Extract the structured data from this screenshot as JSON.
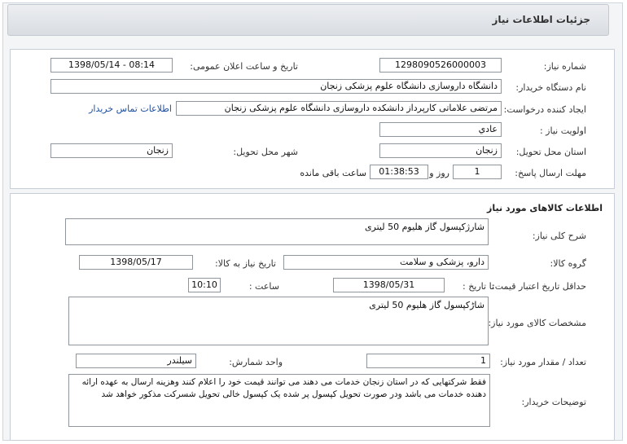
{
  "header": {
    "title": "جزئیات اطلاعات نیاز"
  },
  "info": {
    "need_number_label": "شماره نیاز:",
    "need_number": "1298090526000003",
    "announce_label": "تاریخ و ساعت اعلان عمومی:",
    "announce_value": "1398/05/14 - 08:14",
    "buyer_label": "نام دستگاه خریدار:",
    "buyer_value": "دانشگاه داروسازی دانشگاه علوم پزشکی زنجان",
    "creator_label": "ایجاد کننده درخواست:",
    "creator_value": "مرتضی  علاماتی کارپرداز دانشکده داروسازی دانشگاه علوم پزشکی زنجان",
    "contact_link": "اطلاعات تماس خریدار",
    "priority_label": "اولویت نیاز :",
    "priority_value": "عادي",
    "province_label": "استان محل تحویل:",
    "province_value": "زنجان",
    "city_label": "شهر محل تحویل:",
    "city_value": "زنجان",
    "deadline_label": "مهلت ارسال پاسخ:",
    "deadline_days": "1",
    "days_text": "روز و",
    "deadline_time": "01:38:53",
    "remaining_text": "ساعت باقی مانده"
  },
  "goods": {
    "section_title": "اطلاعات کالاهای مورد نیاز",
    "summary_label": "شرح کلی نیاز:",
    "summary_value": "شارژکپسول گاز هلیوم 50 لیتری",
    "group_label": "گروه کالا:",
    "group_value": "دارو، پزشکی و سلامت",
    "need_date_label": "تاریخ نیاز به کالا:",
    "need_date_value": "1398/05/17",
    "min_validity_label": "حداقل تاریخ اعتبار قیمت:",
    "to_date_label": "تا تاریخ :",
    "to_date_value": "1398/05/31",
    "time_label": "ساعت :",
    "time_value": "10:10",
    "spec_label": "مشخصات کالای مورد نیاز:",
    "spec_value": "شاڑکپسول گاز هلیوم 50 لیتری",
    "qty_label": "تعداد / مقدار مورد نیاز:",
    "qty_value": "1",
    "unit_label": "واحد شمارش:",
    "unit_value": "سیلندر",
    "notes_label": "توضیحات خریدار:",
    "notes_value": "فقط شرکتهایی که در استان زنجان خدمات می دهند می توانند قیمت خود را اعلام کنند وهزینه ارسال به عهده ارائه دهنده خدمات می باشد ودر صورت تحویل کپسول پر شده یک کپسول خالی تحویل شسرکت مذکور خواهد شد"
  }
}
